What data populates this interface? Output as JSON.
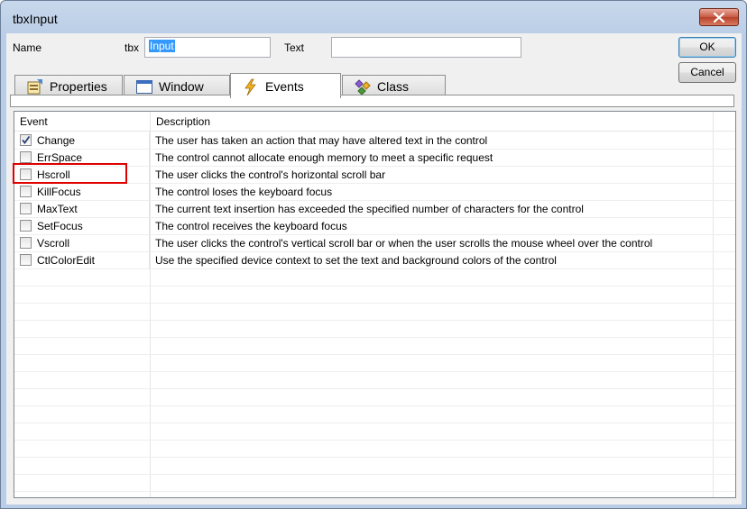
{
  "window": {
    "title": "tbxInput"
  },
  "form": {
    "name_label": "Name",
    "name_prefix": "tbx",
    "name_value": "Input",
    "text_label": "Text",
    "text_value": ""
  },
  "buttons": {
    "ok": "OK",
    "cancel": "Cancel"
  },
  "tabs": [
    {
      "label": "Properties",
      "icon": "properties-icon"
    },
    {
      "label": "Window",
      "icon": "window-icon"
    },
    {
      "label": "Events",
      "icon": "lightning-icon",
      "active": true
    },
    {
      "label": "Class",
      "icon": "class-icon"
    }
  ],
  "grid": {
    "columns": [
      "Event",
      "Description"
    ],
    "rows": [
      {
        "event": "Change",
        "checked": true,
        "description": "The user has taken an action that may have altered text in the control"
      },
      {
        "event": "ErrSpace",
        "checked": false,
        "description": "The control cannot allocate enough memory to meet a specific request"
      },
      {
        "event": "Hscroll",
        "checked": false,
        "description": "The user clicks the control's horizontal scroll bar"
      },
      {
        "event": "KillFocus",
        "checked": false,
        "description": "The control loses the keyboard focus"
      },
      {
        "event": "MaxText",
        "checked": false,
        "description": "The current text insertion has exceeded the specified number of characters for the control"
      },
      {
        "event": "SetFocus",
        "checked": false,
        "description": "The control receives the keyboard focus"
      },
      {
        "event": "Vscroll",
        "checked": false,
        "description": "The user clicks the control's vertical scroll bar or when the user scrolls the mouse wheel over the control"
      },
      {
        "event": "CtlColorEdit",
        "checked": false,
        "description": "Use the specified device context to set the text and background colors of the control"
      }
    ]
  },
  "colors": {
    "highlight": "#e00000",
    "selection": "#3399ff"
  }
}
